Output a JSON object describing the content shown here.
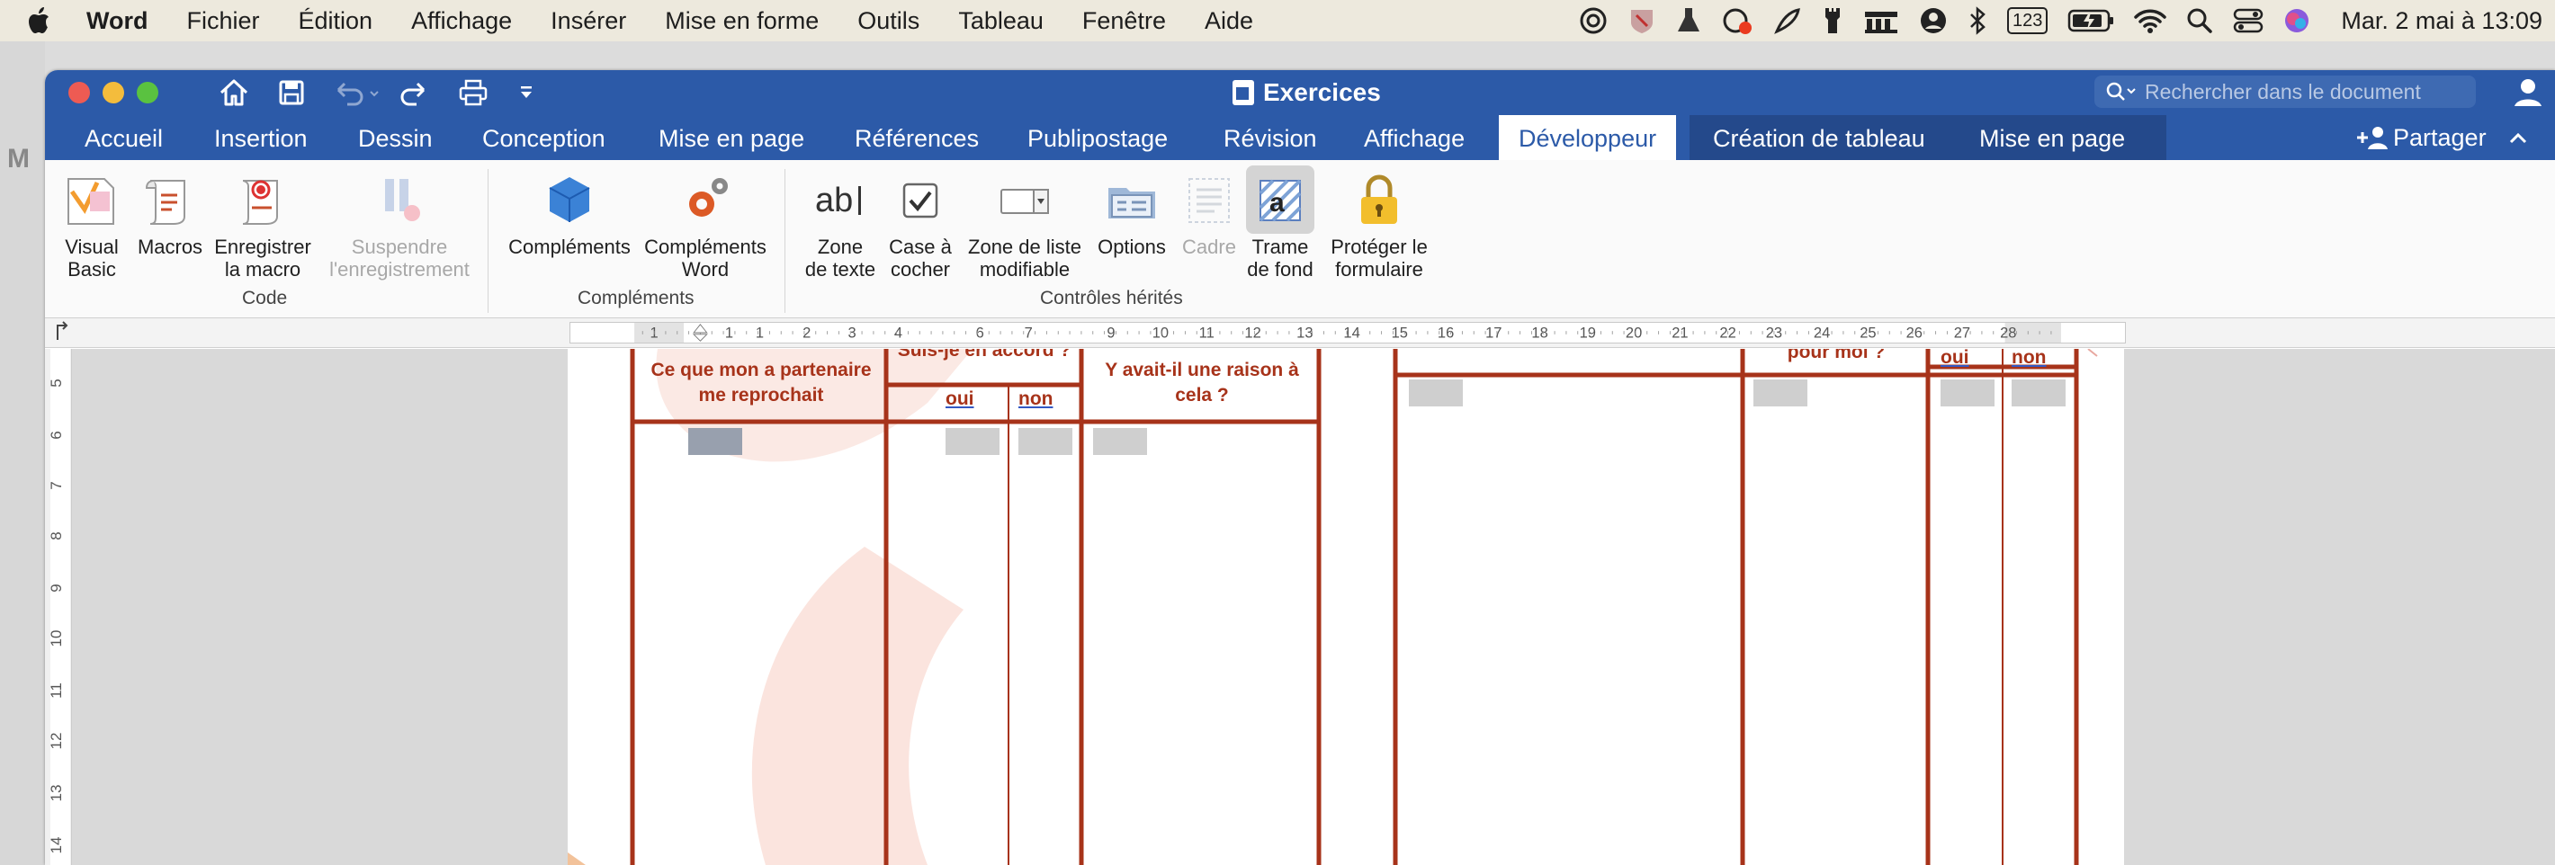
{
  "menubar": {
    "app": "Word",
    "items": [
      "Fichier",
      "Édition",
      "Affichage",
      "Insérer",
      "Mise en forme",
      "Outils",
      "Tableau",
      "Fenêtre",
      "Aide"
    ],
    "clock": "Mar. 2 mai à 13:09",
    "keyboard_badge": "123"
  },
  "window": {
    "title": "Exercices",
    "search_placeholder": "Rechercher dans le document",
    "share_label": "Partager",
    "tabs": [
      "Accueil",
      "Insertion",
      "Dessin",
      "Conception",
      "Mise en page",
      "Références",
      "Publipostage",
      "Révision",
      "Affichage",
      "Développeur"
    ],
    "active_tab": "Développeur",
    "table_tabs": [
      "Création de tableau",
      "Mise en page"
    ]
  },
  "ribbon": {
    "buttons": [
      {
        "label": "Visual\nBasic",
        "icon": "visual-basic-icon"
      },
      {
        "label": "Macros",
        "icon": "macros-icon"
      },
      {
        "label": "Enregistrer\nla macro",
        "icon": "record-macro-icon"
      },
      {
        "label": "Suspendre\nl'enregistrement",
        "icon": "pause-recording-icon",
        "disabled": true
      },
      {
        "label": "Compléments",
        "icon": "add-ins-icon"
      },
      {
        "label": "Compléments\nWord",
        "icon": "word-add-ins-icon"
      },
      {
        "label": "Zone\nde texte",
        "icon": "text-box-icon"
      },
      {
        "label": "Case à\ncocher",
        "icon": "checkbox-icon"
      },
      {
        "label": "Zone de liste\nmodifiable",
        "icon": "combo-box-icon"
      },
      {
        "label": "Options",
        "icon": "options-icon"
      },
      {
        "label": "Cadre",
        "icon": "frame-icon",
        "disabled": true
      },
      {
        "label": "Trame\nde fond",
        "icon": "shading-icon"
      },
      {
        "label": "Protéger le\nformulaire",
        "icon": "lock-icon"
      }
    ],
    "groups": [
      "Code",
      "Compléments",
      "Contrôles hérités"
    ]
  },
  "ruler": {
    "labels": [
      "1",
      "1",
      "1",
      "2",
      "3",
      "4",
      "6",
      "7",
      "9",
      "10",
      "11",
      "12",
      "13",
      "14",
      "15",
      "16",
      "17",
      "18",
      "19",
      "20",
      "21",
      "22",
      "23",
      "24",
      "25",
      "26",
      "27",
      "28"
    ],
    "vlabels": [
      "5",
      "6",
      "7",
      "8",
      "9",
      "10",
      "11",
      "12",
      "13",
      "14"
    ]
  },
  "document": {
    "col1_header": "Ce que mon a partenaire me reprochait",
    "col2_header": "Suis-je en accord ?",
    "col3_header": "Y avait-il une raison à cela ?",
    "col5_header": "pour moi ?",
    "oui": "oui",
    "non": "non"
  }
}
